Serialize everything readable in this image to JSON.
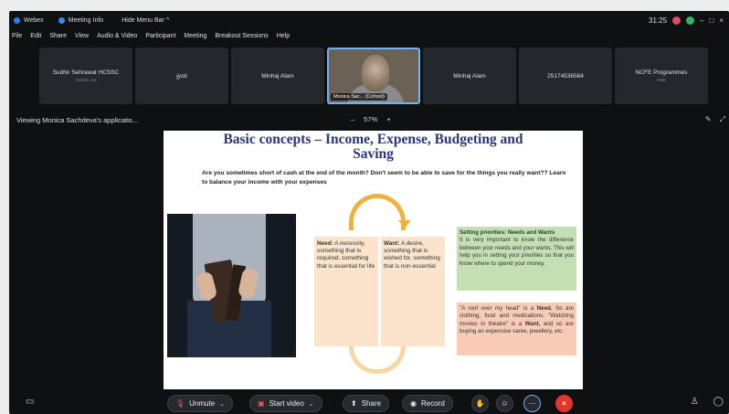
{
  "titlebar": {
    "app_name": "Webex",
    "meeting_info": "Meeting Info",
    "hide_menu": "Hide Menu Bar ^",
    "time": "31:25",
    "minimize": "–",
    "restore": "□",
    "close": "×"
  },
  "menu": [
    "File",
    "Edit",
    "Share",
    "View",
    "Audio & Video",
    "Participant",
    "Meeting",
    "Breakout Sessions",
    "Help"
  ],
  "participants": [
    {
      "name": "Sudhir Sehrawat HCSSC",
      "sub": "Cohost, me"
    },
    {
      "name": "jyoti",
      "sub": ""
    },
    {
      "name": "Minhaj Alam",
      "sub": ""
    },
    {
      "name": "Monica Sac... (Cohost)",
      "sub": ""
    },
    {
      "name": "Minhaj Alam",
      "sub": ""
    },
    {
      "name": "25174536584",
      "sub": ""
    },
    {
      "name": "NCFE Programmes",
      "sub": "Host"
    }
  ],
  "viewbar": {
    "viewing": "Viewing Monica Sachdeva's applicatio...",
    "zoom_minus": "–",
    "zoom": "57%",
    "zoom_plus": "+"
  },
  "slide": {
    "title_line1": "Basic concepts – Income, Expense, Budgeting and",
    "title_line2": "Saving",
    "intro": "Are you sometimes short of cash at the end of the month? Don't seem to be able to save for the things you really want?? Learn to balance your income with your expenses",
    "need_label": "Need:",
    "need_text": " A necessity, something that is required, something that is essential for life",
    "want_label": "Want:",
    "want_text": " A desire, something that is wished for, something that is non-essential",
    "prio_heading": "Setting priorities: Needs and Wants",
    "prio_text": "It is very important to know the difference between your needs and your wants. This will help you in setting your priorities so that you know where to spend your money.",
    "roof_a": "\"A roof over my head\" is a ",
    "roof_need": "Need.",
    "roof_b": " So are clothing, food and medications. \"Watching movies in theatre\" is a ",
    "roof_want": "Want,",
    "roof_c": " and so are buying an expensive saree, jewellery, etc."
  },
  "toolbar": {
    "unmute": "Unmute",
    "start_video": "Start video",
    "share": "Share",
    "record": "Record"
  },
  "colors": {
    "title_blue": "#2b3575",
    "prio_green": "#c4dfb4",
    "roof_salmon": "#f7cbb5",
    "arrow_orange": "#f0b23a",
    "end_red": "#e5352b"
  }
}
